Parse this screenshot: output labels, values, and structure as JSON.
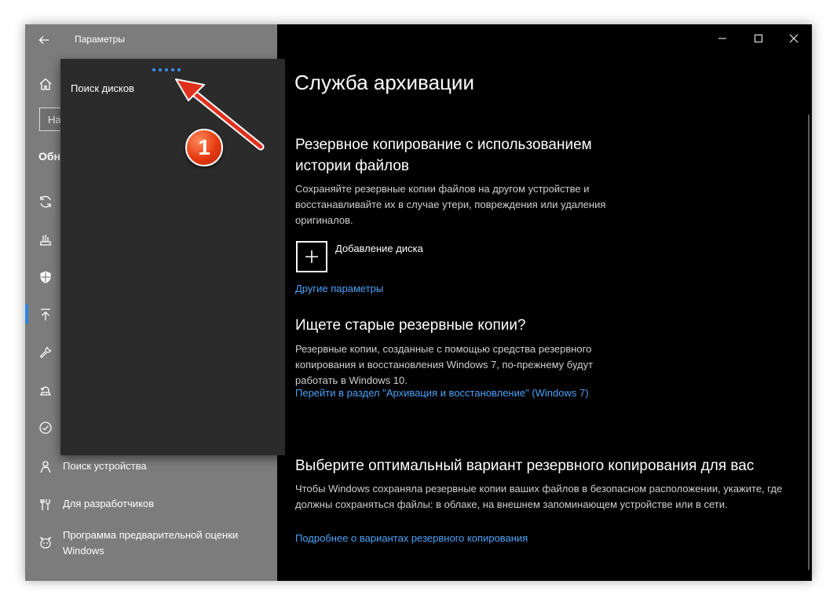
{
  "window": {
    "app_title": "Параметры"
  },
  "nav": {
    "search_text": "На",
    "section_heading": "Обн",
    "items": [
      {
        "label": "Поиск устройства",
        "icon": "person-location-icon"
      },
      {
        "label": "Для разработчиков",
        "icon": "developer-tools-icon"
      },
      {
        "label": "Программа предварительной оценки Windows",
        "icon": "insider-cat-icon"
      }
    ]
  },
  "flyout": {
    "label": "Поиск дисков"
  },
  "content": {
    "page_title": "Служба архивации",
    "file_history": {
      "heading": "Резервное копирование с использованием истории файлов",
      "description": "Сохраняйте резервные копии файлов на другом устройстве и восстанавливайте их в случае утери, повреждения или удаления оригиналов.",
      "add_drive_label": "Добавление диска",
      "more_options_link": "Другие параметры"
    },
    "old_backups": {
      "heading": "Ищете старые резервные копии?",
      "description": "Резервные копии, созданные с помощью средства резервного копирования и восстановления Windows 7, по-прежнему будут работать в Windows 10.",
      "link": "Перейти в раздел \"Архивация и восстановление\" (Windows 7)"
    },
    "choose_option": {
      "heading": "Выберите оптимальный вариант резервного копирования для вас",
      "description": "Чтобы Windows сохраняла резервные копии ваших файлов в безопасном расположении, укажите, где должны сохраняться файлы: в облаке, на внешнем запоминающем устройстве или в сети.",
      "link": "Подробнее о вариантах резервного копирования"
    }
  },
  "annotation": {
    "badge_number": "1"
  },
  "colors": {
    "accent": "#2a86e0",
    "link": "#4aa3f7",
    "badge": "#e53a10"
  }
}
